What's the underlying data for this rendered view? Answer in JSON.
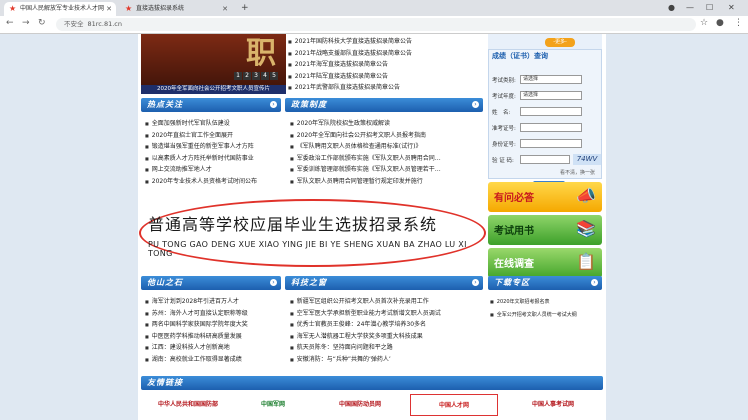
{
  "browser": {
    "tabs": [
      {
        "title": "中国人民解放军专业技术人才网",
        "active": true
      },
      {
        "title": "直接选拔招录系统",
        "active": false
      }
    ],
    "security": "不安全",
    "url": "81rc.81.cn"
  },
  "banner": {
    "big_text": "职",
    "pages": [
      "1",
      "2",
      "3",
      "4",
      "5"
    ],
    "caption": "2020年全军面向社会公开招考文职人员宣传片"
  },
  "top_news": [
    "2021年国防科技大学直接选拔招录简章公告",
    "2021年战略支援部队直接选拔招录简章公告",
    "2021年海军直接选拔招录简章公告",
    "2021年陆军直接选拔招录简章公告",
    "2021年武警部队直接选拔招录简章公告"
  ],
  "sections": {
    "hot_title": "热点关注",
    "policy_title": "政策制度",
    "talent_title": "他山之石",
    "tech_title": "科技之窗",
    "download_title": "下载专区",
    "links_title": "友情链接"
  },
  "hot_list": [
    "全面加强新时代军官队伍建设",
    "2020年直招士官工作全面展开",
    "锻造堪当强军重任的新型军事人才方阵",
    "以高素质人才方阵托举新时代国防事业",
    "网上交流助推军地人才",
    "2020年专业技术人员资格考试时间公布"
  ],
  "policy_list": [
    "2020年军队院校招生政策权威解读",
    "2020年全军面向社会公开招考文职人员报考指南",
    "《军队聘用文职人员体格检查通用标准(试行)》",
    "军委政治工作部就颁布实施《军队文职人员聘用合同…",
    "军委训练管理部就颁布实施《军队文职人员管理若干…",
    "军队文职人员聘用合同管理暂行规定印发并施行"
  ],
  "cj": {
    "title": "成绩（证书）查询",
    "more": "-更多-",
    "labels": [
      "考试类别:",
      "考试年度:",
      "姓　名:",
      "准考证号:",
      "身份证号:",
      "验 证 码:"
    ],
    "sel1": "请选择",
    "sel2": "请选择",
    "captcha": "74WV",
    "note": "看不清，换一张",
    "query": "查 询"
  },
  "ads": [
    {
      "label": "有问必答",
      "deco": "📣"
    },
    {
      "label": "考试用书",
      "deco": "📚"
    },
    {
      "label": "在线调查",
      "deco": "📋"
    }
  ],
  "promo": {
    "cn": "普通高等学校应届毕业生选拔招录系统",
    "py": "PU TONG GAO DENG XUE XIAO YING JIE BI YE SHENG XUAN BA ZHAO LU XI TONG"
  },
  "talent_list": [
    "海军计划到2028年引进百万人才",
    "苏州：海外人才可直接认定职称等级",
    "两名中国科学家获国际学院年度大奖",
    "中医医药学科推动科研高质量发展",
    "江西：建设科技人才创新高地",
    "湖南：高校就业工作取得显著成绩"
  ],
  "tech_list": [
    "新疆军区组织公开招考文职人员首次补充录用工作",
    "空军军医大学承担新型职业能力考试新增文职人员调试",
    "优秀士官教员王俊峰：24年潜心教学培养30多名",
    "海军无人潜航器工程大学获奖多项重大科技成果",
    "航天员陈冬：坚持面向问题和平之路",
    "安徽消防：与“兵种”共舞的‘弹药人’"
  ],
  "download_list": [
    "2020年文职招考报名表",
    "全军公开招考文职人员统一考试大纲"
  ],
  "links": [
    "中华人民共和国国防部",
    "中国军网",
    "中国国防动员网",
    "中国人才网",
    "中国人事考试网"
  ]
}
